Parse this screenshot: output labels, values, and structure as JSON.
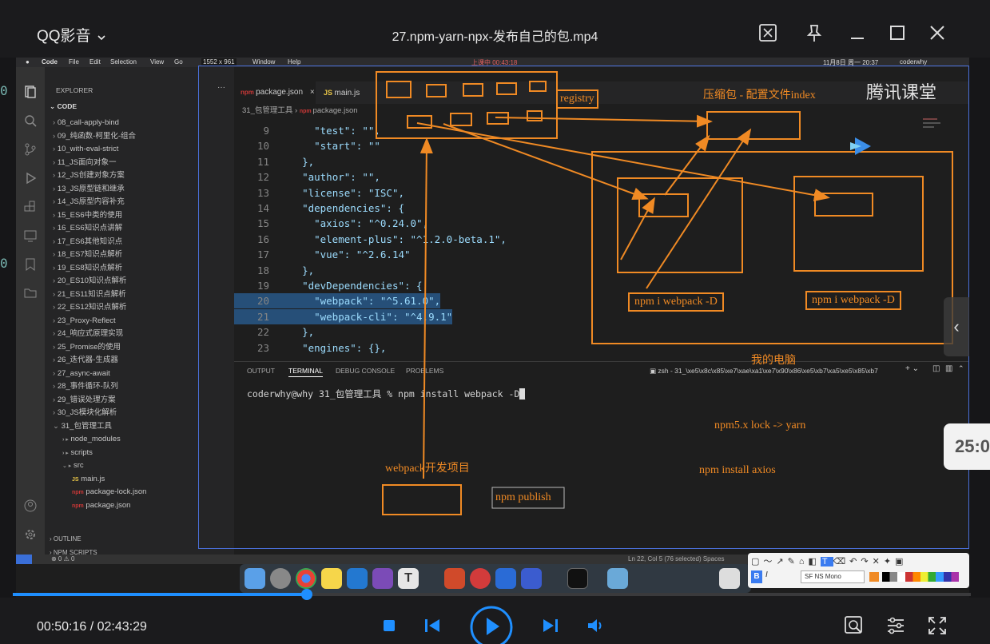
{
  "app": {
    "name": "QQ影音",
    "chevron": "⌄"
  },
  "video": {
    "title": "27.npm-yarn-npx-发布自己的包.mp4"
  },
  "window_controls": [
    "screenshot-icon",
    "pin-icon",
    "minimize-icon",
    "maximize-icon",
    "close-icon"
  ],
  "mac_menubar": {
    "items": [
      "Code",
      "File",
      "Edit",
      "Selection",
      "View",
      "Go"
    ],
    "items2": [
      "Window",
      "Help"
    ],
    "size_badge": "1552 x 961",
    "recording": "上课中 00:43:18",
    "clock": "11月8日 周一 20:37",
    "user": "coderwhy"
  },
  "explorer": {
    "header": "EXPLORER",
    "section": "CODE",
    "items": [
      "08_call-apply-bind",
      "09_纯函数-柯里化-组合",
      "10_with-eval-strict",
      "11_JS面向对象一",
      "12_JS创建对象方案",
      "13_JS原型链和继承",
      "14_JS原型内容补充",
      "15_ES6中类的使用",
      "16_ES6知识点讲解",
      "17_ES6其他知识点",
      "18_ES7知识点解析",
      "19_ES8知识点解析",
      "20_ES10知识点解析",
      "21_ES11知识点解析",
      "22_ES12知识点解析",
      "23_Proxy-Reflect",
      "24_响应式原理实现",
      "25_Promise的使用",
      "26_迭代器-生成器",
      "27_async-await",
      "28_事件循环-队列",
      "29_错误处理方案",
      "30_JS模块化解析",
      "31_包管理工具"
    ],
    "subitems": [
      "node_modules",
      "scripts",
      "src",
      "main.js",
      "package-lock.json",
      "package.json"
    ],
    "outline": "OUTLINE",
    "npm_scripts": "NPM SCRIPTS"
  },
  "editor": {
    "tabs": [
      "package.json",
      "main.js"
    ],
    "breadcrumb": [
      "31_包管理工具",
      "package.json"
    ],
    "lines": [
      {
        "n": "9",
        "text": "\"test\": \"\","
      },
      {
        "n": "10",
        "text": "\"start\": \"\""
      },
      {
        "n": "11",
        "text": "},"
      },
      {
        "n": "12",
        "text": "\"author\": \"\","
      },
      {
        "n": "13",
        "text": "\"license\": \"ISC\","
      },
      {
        "n": "14",
        "text": "\"dependencies\": {"
      },
      {
        "n": "15",
        "text": "\"axios\": \"^0.24.0\","
      },
      {
        "n": "16",
        "text": "\"element-plus\": \"^1.2.0-beta.1\","
      },
      {
        "n": "17",
        "text": "\"vue\": \"^2.6.14\""
      },
      {
        "n": "18",
        "text": "},"
      },
      {
        "n": "19",
        "text": "\"devDependencies\": {"
      },
      {
        "n": "20",
        "text": "\"webpack\": \"^5.61.0\","
      },
      {
        "n": "21",
        "text": "\"webpack-cli\": \"^4.9.1\""
      },
      {
        "n": "22",
        "text": "},"
      },
      {
        "n": "23",
        "text": "\"engines\": {},"
      }
    ]
  },
  "panel": {
    "tabs": [
      "OUTPUT",
      "TERMINAL",
      "DEBUG CONSOLE",
      "PROBLEMS"
    ],
    "shell": "zsh - 31_\\xe5\\x8c\\x85\\xe7\\xae\\xa1\\xe7\\x90\\x86\\xe5\\xb7\\xa5\\xe5\\x85\\xb7",
    "prompt": "coderwhy@why 31_包管理工具 % npm install webpack -D"
  },
  "status": {
    "left": "⊗ 0 ⚠ 0",
    "right": "Ln 22, Col 5 (76 selected)   Spaces"
  },
  "annotations": {
    "registry": "registry",
    "zip_package": "压缩包 - 配置文件index",
    "install_1": "npm i webpack -D",
    "install_2": "npm i webpack -D",
    "my_computer": "我的电脑",
    "lock": "npm5.x lock -> yarn",
    "axios": "npm install axios",
    "project": "webpack开发项目",
    "publish": "npm publish"
  },
  "toolbar": {
    "font": "SF NS Mono"
  },
  "brand": {
    "name": "腾讯课堂"
  },
  "overlay": {
    "timer": "25:0"
  },
  "playback": {
    "current": "00:50:16",
    "total": "02:43:29",
    "separator": " / ",
    "progress": 0.3068
  },
  "colors": {
    "accent": "#1f8fff",
    "annotation": "#f08a24"
  }
}
